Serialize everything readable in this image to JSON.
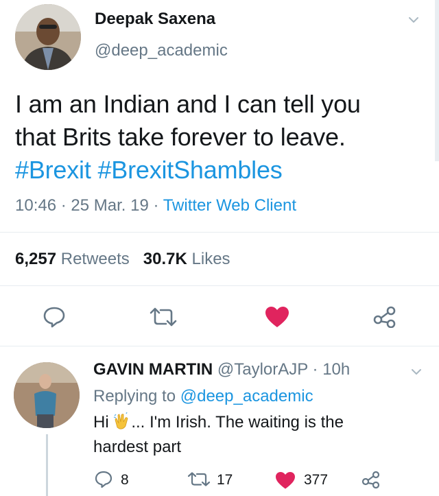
{
  "tweet": {
    "author_name": "Deepak Saxena",
    "author_handle": "@deep_academic",
    "text_line1": "I am an Indian and I can tell you",
    "text_line2": "that Brits take forever to leave.",
    "hashtag1": "#Brexit",
    "hashtag2": "#BrexitShambles",
    "time": "10:46",
    "date": "25 Mar. 19",
    "sep": "·",
    "client": "Twitter Web Client",
    "retweets_count": "6,257",
    "retweets_label": "Retweets",
    "likes_count": "30.7K",
    "likes_label": "Likes",
    "liked": true
  },
  "reply": {
    "author_name": "GAVIN MARTIN",
    "author_handle": "@TaylorAJP",
    "sep": "·",
    "age": "10h",
    "replying_prefix": "Replying to",
    "replying_handle": "@deep_academic",
    "text_before_emoji": "Hi ",
    "text_after_emoji": "... I'm Irish. The waiting is the",
    "text_line2": "hardest part",
    "replies": "8",
    "retweets": "17",
    "likes": "377"
  },
  "icons": {
    "reply": "speech-bubble-icon",
    "retweet": "retweet-arrows-icon",
    "like": "heart-icon",
    "share": "share-nodes-icon",
    "menu": "chevron-down-icon",
    "emoji": "clapping-hands-emoji"
  },
  "colors": {
    "link": "#1b95e0",
    "muted": "#657786",
    "heart": "#e0245e",
    "text": "#14171a"
  }
}
